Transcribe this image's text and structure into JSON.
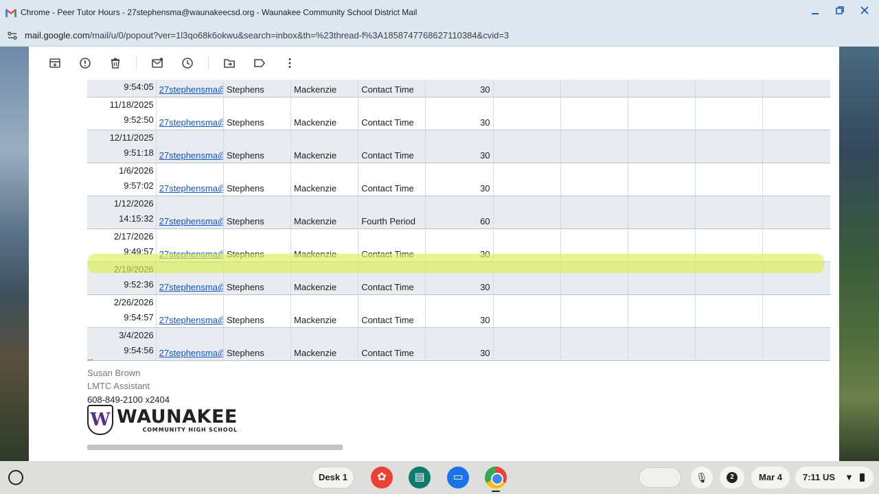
{
  "window": {
    "title": "Chrome - Peer Tutor Hours - 27stephensma@waunakeecsd.org - Waunakee Community School District Mail",
    "minimize_icon": "minimize-icon",
    "maximize_icon": "restore-icon",
    "close_icon": "close-icon"
  },
  "urlbar": {
    "host": "mail.google.com",
    "path": "/mail/u/0/popout?ver=1l3qo68k6okwu&search=inbox&th=%23thread-f%3A1858747768627110384&cvid=3"
  },
  "toolbar": {
    "icons": [
      "archive-icon",
      "report-spam-icon",
      "delete-icon",
      "mark-unread-icon",
      "snooze-icon",
      "move-to-icon",
      "label-icon",
      "more-icon"
    ]
  },
  "table": {
    "rows": [
      {
        "date": "",
        "time": "9:54:05",
        "email": "27stephensma@",
        "last": "Stephens",
        "first": "Mackenzie",
        "type": "Contact Time",
        "minutes": "30"
      },
      {
        "date": "11/18/2025",
        "time": "9:52:50",
        "email": "27stephensma@",
        "last": "Stephens",
        "first": "Mackenzie",
        "type": "Contact Time",
        "minutes": "30"
      },
      {
        "date": "12/11/2025",
        "time": "9:51:18",
        "email": "27stephensma@",
        "last": "Stephens",
        "first": "Mackenzie",
        "type": "Contact Time",
        "minutes": "30"
      },
      {
        "date": "1/6/2026",
        "time": "9:57:02",
        "email": "27stephensma@",
        "last": "Stephens",
        "first": "Mackenzie",
        "type": "Contact Time",
        "minutes": "30"
      },
      {
        "date": "1/12/2026",
        "time": "14:15:32",
        "email": "27stephensma@",
        "last": "Stephens",
        "first": "Mackenzie",
        "type": "Fourth Period",
        "minutes": "60"
      },
      {
        "date": "2/17/2026",
        "time": "9:49:57",
        "email": "27stephensma@",
        "last": "Stephens",
        "first": "Mackenzie",
        "type": "Contact Time",
        "minutes": "30"
      },
      {
        "date": "2/19/2026",
        "time": "9:52:36",
        "email": "27stephensma@",
        "last": "Stephens",
        "first": "Mackenzie",
        "type": "Contact Time",
        "minutes": "30"
      },
      {
        "date": "2/26/2026",
        "time": "9:54:57",
        "email": "27stephensma@",
        "last": "Stephens",
        "first": "Mackenzie",
        "type": "Contact Time",
        "minutes": "30"
      },
      {
        "date": "3/4/2026",
        "time": "9:54:56",
        "email": "27stephensma@",
        "last": "Stephens",
        "first": "Mackenzie",
        "type": "Contact Time",
        "minutes": "30"
      }
    ]
  },
  "signature": {
    "dashes": "--",
    "name": "Susan Brown",
    "role": "LMTC Assistant",
    "phone": "608-849-2100 x2404",
    "logo_letter": "W",
    "logo_main": "WAUNAKEE",
    "logo_sub": "COMMUNITY HIGH SCHOOL"
  },
  "shelf": {
    "desk": "Desk 1",
    "notification_count": "2",
    "date": "Mar 4",
    "time": "7:11",
    "locale": "US",
    "apps": [
      "palette-icon",
      "classroom-icon",
      "files-icon",
      "chrome-icon"
    ]
  },
  "colors": {
    "link": "#1155cc",
    "highlight": "#dcee50",
    "row_shade": "#e8ebef"
  }
}
